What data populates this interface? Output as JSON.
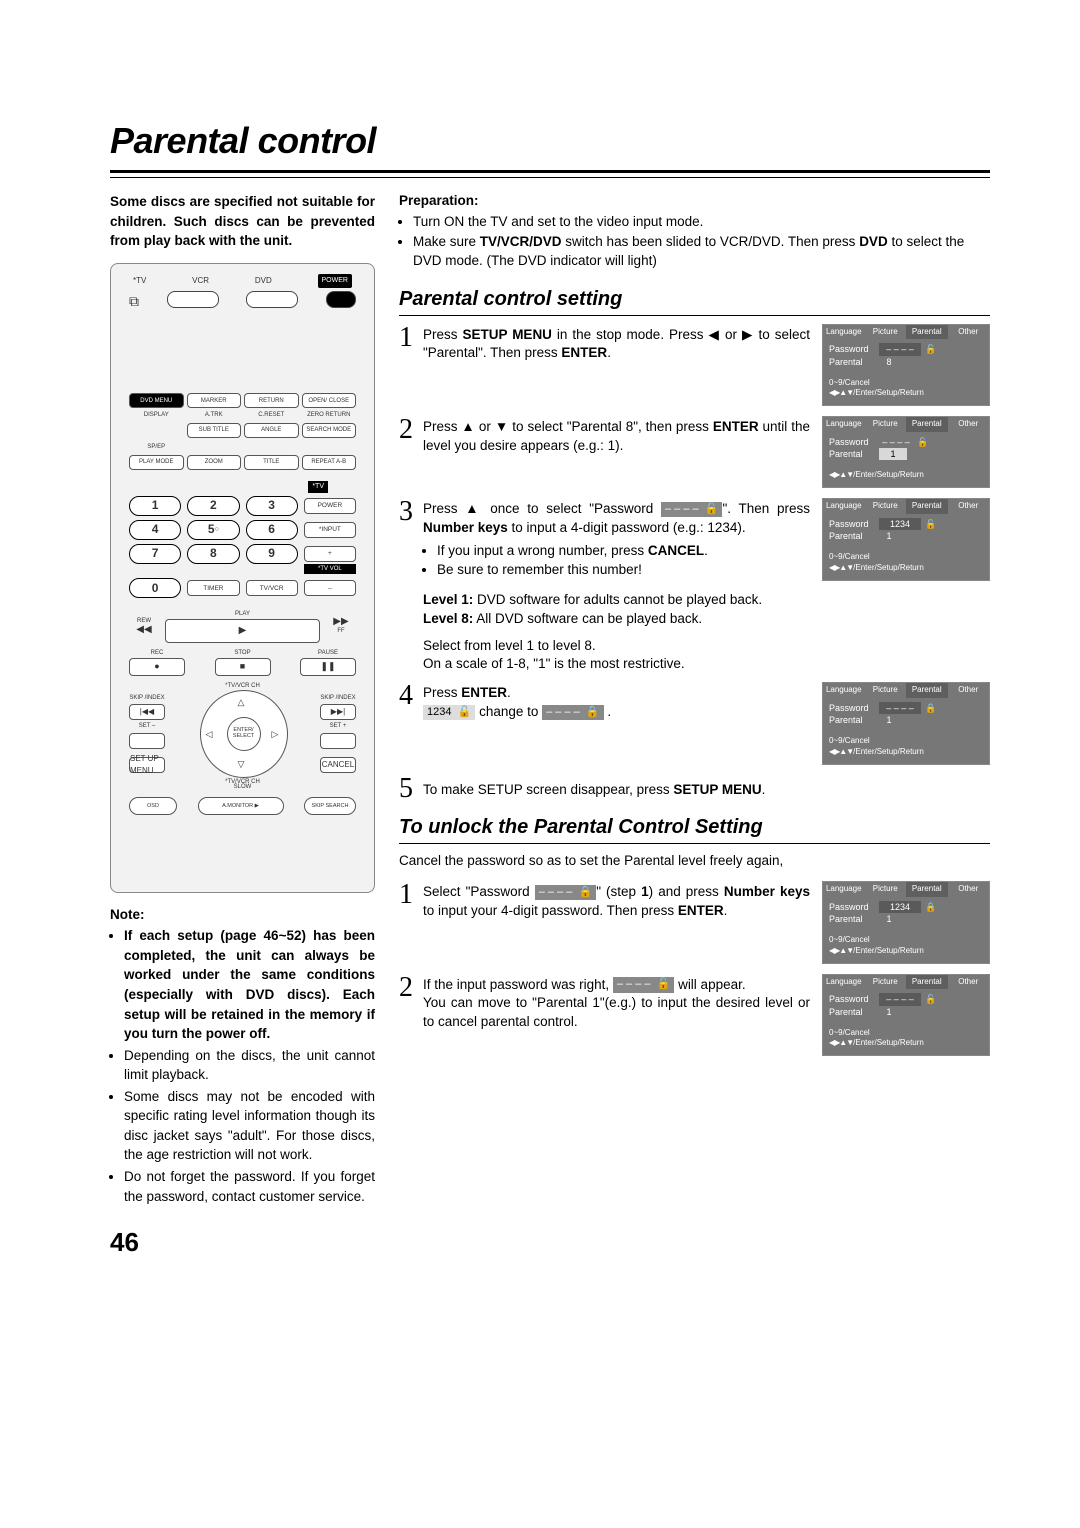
{
  "title": "Parental control",
  "intro": "Some discs are specified not suitable for children. Such discs can be prevented from play back with the unit.",
  "remote": {
    "top": {
      "tv": "*TV",
      "vcr": "VCR",
      "dvd": "DVD",
      "power": "POWER"
    },
    "row1": [
      "DVD MENU",
      "MARKER",
      "RETURN",
      "OPEN/ CLOSE"
    ],
    "row1b": [
      "DISPLAY",
      "A.TRK",
      "C.RESET",
      "ZERO RETURN"
    ],
    "row2": [
      "SUB TITLE",
      "ANGLE",
      "SEARCH MODE"
    ],
    "row2b": [
      "SP/EP"
    ],
    "row3": [
      "PLAY MODE",
      "ZOOM",
      "TITLE",
      "REPEAT A-B"
    ],
    "tv_label": "*TV",
    "numside": [
      "POWER",
      "*INPUT",
      "+",
      "TV/VCR",
      "–"
    ],
    "tvvol": "*TV VOL",
    "numbers": [
      "1",
      "2",
      "3",
      "4",
      "5",
      "6",
      "7",
      "8",
      "9",
      "0"
    ],
    "timer": "TIMER",
    "transport": {
      "rew": "REW",
      "play": "PLAY",
      "ff": "FF",
      "rec": "REC",
      "stop": "STOP",
      "pause": "PAUSE"
    },
    "skip": "SKIP /INDEX",
    "ch": "*TV/VCR CH",
    "set_minus": "SET –",
    "set_plus": "SET +",
    "enter": "ENTER/ SELECT",
    "setup": "SET UP MENU",
    "cancel": "CANCEL",
    "slow": "SLOW",
    "osd": "OSD",
    "amonitor": "A.MONITOR",
    "skipsearch": "SKIP SEARCH"
  },
  "note_head": "Note:",
  "notes": [
    "If each setup (page 46~52) has been completed, the unit can always be worked under the same conditions (especially with DVD discs). Each setup will be retained in the memory if you turn the power off.",
    "Depending on the discs, the unit cannot limit playback.",
    "Some discs may not be encoded with specific rating level information though its disc jacket says \"adult\". For those discs, the age restriction will not work.",
    "Do not forget the password. If you forget the password, contact customer service."
  ],
  "note_first_bold_upto": 1,
  "prep_head": "Preparation:",
  "prep": [
    "Turn ON the TV and set to the video input mode.",
    "Make sure TV/VCR/DVD switch has been slided to VCR/DVD. Then press DVD to select the DVD mode. (The DVD indicator will light)"
  ],
  "section1": "Parental control setting",
  "steps1": {
    "s1_a": "Press ",
    "s1_b": "SETUP MENU",
    "s1_c": " in the stop mode. Press ◀ or ▶ to select \"Parental\". Then press ",
    "s1_d": "ENTER",
    "s1_e": ".",
    "s2_a": "Press ▲ or ▼ to select \"Parental 8\", then press ",
    "s2_b": "ENTER",
    "s2_c": " until the level you desire appears (e.g.: 1).",
    "s3_a": "Press ▲ once to select \"Password ",
    "s3_b": "\". Then press ",
    "s3_c": "Number keys",
    "s3_d": " to input a 4-digit password (e.g.: 1234).",
    "s3_bul1_a": "If you input a wrong number, press ",
    "s3_bul1_b": "CANCEL",
    "s3_bul1_c": ".",
    "s3_bul2": "Be sure to remember this number!",
    "levels_a": "Level 1:",
    "levels_at": " DVD software for adults cannot be played back.",
    "levels_b": "Level 8:",
    "levels_bt": " All DVD software can be played back.",
    "scale1": "Select from level 1 to level 8.",
    "scale2": "On a scale of 1-8, \"1\" is the most restrictive.",
    "s4_a": "Press ",
    "s4_b": "ENTER",
    "s4_c": ".",
    "s4_row_a": "1234",
    "s4_row_b": " change to ",
    "s4_row_c": "– – – –",
    "s5_a": "To make SETUP screen disappear, press ",
    "s5_b": "SETUP MENU",
    "s5_c": "."
  },
  "osd_common": {
    "tabs": [
      "Language",
      "Picture",
      "Parental",
      "Other"
    ],
    "password": "Password",
    "parental": "Parental",
    "cancel": "0~9/Cancel",
    "hint": "/Enter/Setup/Return"
  },
  "osd1": {
    "pwd": "– – – –",
    "par": "8",
    "lock": "open",
    "cancel": true,
    "sel": "pwd"
  },
  "osd2": {
    "pwd": "– – – –",
    "par": "1",
    "lock": "open",
    "cancel": false,
    "sel": "par"
  },
  "osd3": {
    "pwd": "1234",
    "par": "1",
    "lock": "open",
    "cancel": true,
    "sel": "pwd"
  },
  "osd4": {
    "pwd": "– – – –",
    "par": "1",
    "lock": "closed",
    "cancel": true,
    "sel": "pwd"
  },
  "section2": "To unlock the Parental Control Setting",
  "unlock_intro": "Cancel the password so as to set the Parental level freely again,",
  "steps2": {
    "s1_a": "Select \"Password ",
    "s1_b": "\" (step ",
    "s1_c": "1",
    "s1_d": ") and press ",
    "s1_e": "Number keys",
    "s1_f": " to input your 4-digit password. Then press ",
    "s1_g": "ENTER",
    "s1_h": ".",
    "s1_box": "– – – –",
    "s2_a": "If the input password was right, ",
    "s2_b": " will appear.",
    "s2_c": "You can move to \"Parental 1\"(e.g.) to input the desired level or to cancel parental control.",
    "s2_box": "– – – –"
  },
  "osdU1": {
    "pwd": "1234",
    "par": "1",
    "lock": "closed",
    "cancel": true,
    "sel": "pwd"
  },
  "osdU2": {
    "pwd": "– – – –",
    "par": "1",
    "lock": "open",
    "cancel": true,
    "sel": "pwd"
  },
  "page_num": "46"
}
